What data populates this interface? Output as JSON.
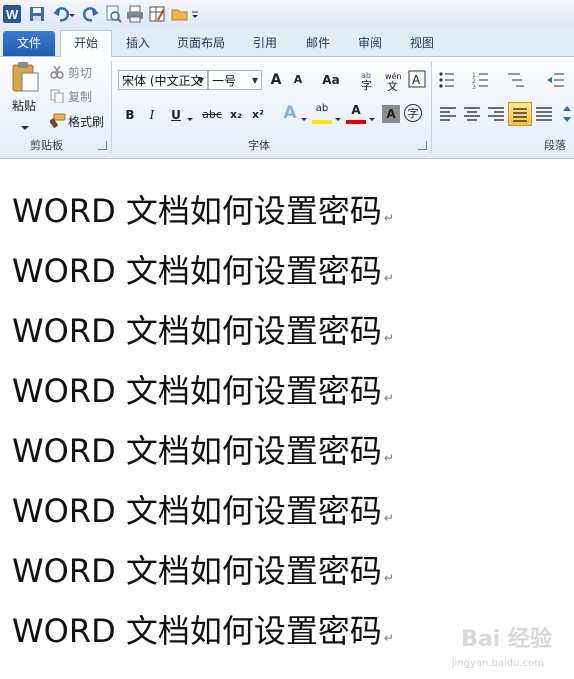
{
  "tabs": [
    {
      "label": "文件"
    },
    {
      "label": "开始"
    },
    {
      "label": "插入"
    },
    {
      "label": "页面布局"
    },
    {
      "label": "引用"
    },
    {
      "label": "邮件"
    },
    {
      "label": "审阅"
    },
    {
      "label": "视图"
    }
  ],
  "clipboard": {
    "paste_label": "粘贴",
    "cut_label": "剪切",
    "copy_label": "复制",
    "format_painter_label": "格式刷",
    "group_label": "剪贴板"
  },
  "font": {
    "font_name": "宋体 (中文正文",
    "font_size": "一号",
    "grow_glyph": "A",
    "shrink_glyph": "A",
    "case_glyph": "Aa",
    "bold": "B",
    "italic": "I",
    "underline": "U",
    "strike": "abc",
    "subscript": "x₂",
    "superscript": "x²",
    "text_effect": "A",
    "highlight": "ab",
    "font_color": "A",
    "shading": "A",
    "enclose": "字",
    "group_label": "字体"
  },
  "paragraph": {
    "group_label": "段落"
  },
  "document": {
    "lines": [
      "WORD 文档如何设置密码",
      "WORD 文档如何设置密码",
      "WORD 文档如何设置密码",
      "WORD 文档如何设置密码",
      "WORD 文档如何设置密码",
      "WORD 文档如何设置密码",
      "WORD 文档如何设置密码",
      "WORD 文档如何设置密码"
    ],
    "para_mark": "↵"
  },
  "watermark": {
    "brand": "Bai 经验",
    "url": "jingyan.baidu.com"
  },
  "colors": {
    "accent": "#1f5eb4",
    "highlight": "#ffe600",
    "font_red": "#e00000"
  }
}
